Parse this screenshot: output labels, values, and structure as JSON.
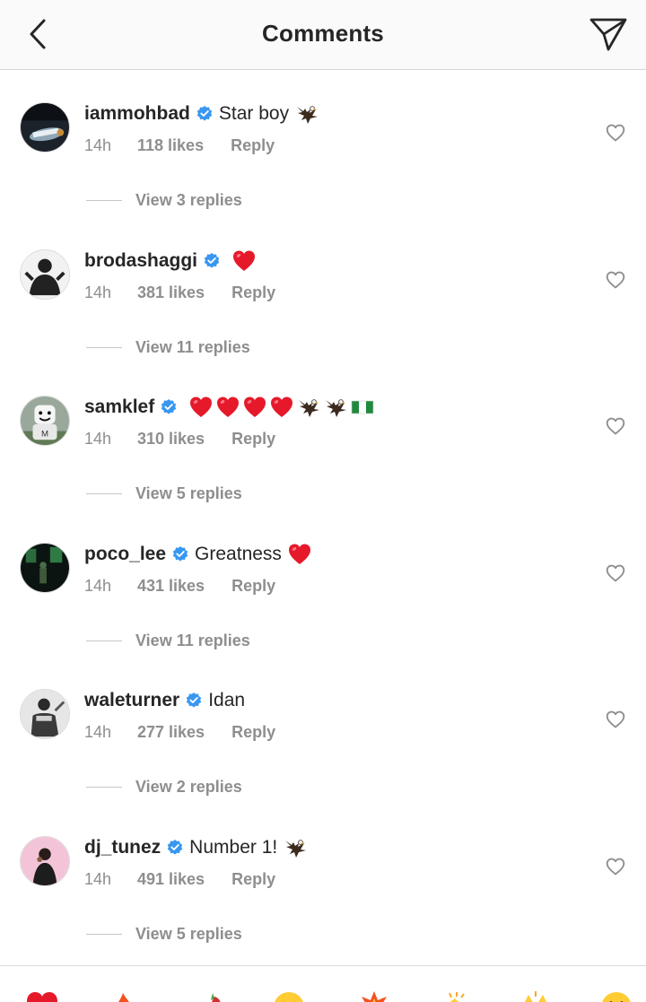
{
  "header": {
    "title": "Comments",
    "back_icon": "chevron-left-icon",
    "send_icon": "paper-plane-icon"
  },
  "colors": {
    "verified_blue": "#3897f0",
    "text_primary": "#262626",
    "text_secondary": "#8e8e8e",
    "heart_red": "#ed4956"
  },
  "comments": [
    {
      "username": "iammohbad",
      "verified": true,
      "text": "Star boy",
      "emojis": [
        "eagle"
      ],
      "time": "14h",
      "likes": "118 likes",
      "reply_label": "Reply",
      "view_replies": "View 3 replies"
    },
    {
      "username": "brodashaggi",
      "verified": true,
      "text": "",
      "emojis": [
        "red-heart"
      ],
      "time": "14h",
      "likes": "381 likes",
      "reply_label": "Reply",
      "view_replies": "View 11 replies"
    },
    {
      "username": "samklef",
      "verified": true,
      "text": "",
      "emojis": [
        "red-heart",
        "red-heart",
        "red-heart",
        "red-heart",
        "eagle",
        "eagle",
        "nigeria-flag"
      ],
      "time": "14h",
      "likes": "310 likes",
      "reply_label": "Reply",
      "view_replies": "View 5 replies"
    },
    {
      "username": "poco_lee",
      "verified": true,
      "text": "Greatness",
      "emojis": [
        "red-heart"
      ],
      "time": "14h",
      "likes": "431 likes",
      "reply_label": "Reply",
      "view_replies": "View 11 replies"
    },
    {
      "username": "waleturner",
      "verified": true,
      "text": "Idan",
      "emojis": [],
      "time": "14h",
      "likes": "277 likes",
      "reply_label": "Reply",
      "view_replies": "View 2 replies"
    },
    {
      "username": "dj_tunez",
      "verified": true,
      "text": "Number 1!",
      "emojis": [
        "eagle"
      ],
      "time": "14h",
      "likes": "491 likes",
      "reply_label": "Reply",
      "view_replies": "View 5 replies"
    }
  ],
  "quick_reactions": [
    "red-heart",
    "fire",
    "chili",
    "grinning-face",
    "explosion",
    "clapping",
    "raised-hands",
    "smiling-face"
  ]
}
